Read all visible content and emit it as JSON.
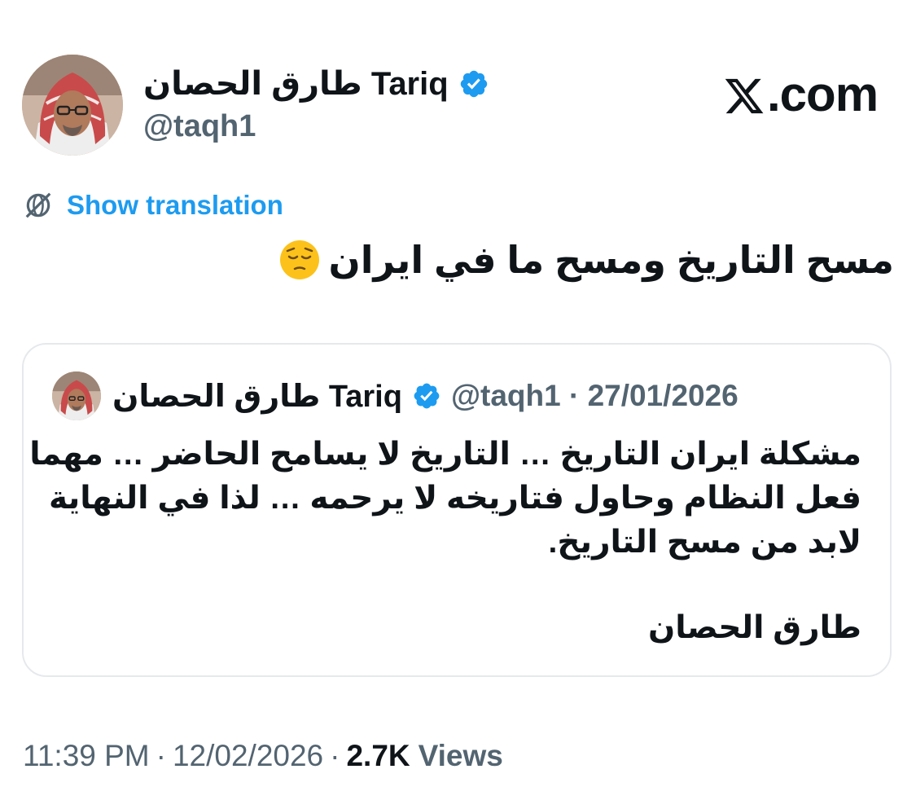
{
  "colors": {
    "verified_badge": "#1d9bf0",
    "link": "#1d9bf0",
    "secondary_text": "#536471",
    "primary_text": "#0f1419",
    "card_border": "#e6e9ec"
  },
  "header": {
    "author_name": "طارق الحصان Tariq",
    "author_handle": "@taqh1",
    "verified_icon": "verified-badge-icon",
    "site_label": ".com",
    "site_logo_icon": "x-logo-icon"
  },
  "translation": {
    "icon": "globe-translate-icon",
    "label": "Show translation"
  },
  "tweet": {
    "text": "مسح التاريخ ومسح ما في ايران",
    "emoji_icon": "pensive-face-emoji"
  },
  "quoted_tweet": {
    "author_name": "طارق الحصان Tariq",
    "handle_date": "@taqh1 · 27/01/2026",
    "body_lines": [
      "مشكلة ايران التاريخ … التاريخ لا يسامح الحاضر … مهما",
      "فعل النظام وحاول فتاريخه لا يرحمه … لذا في النهاية",
      "لابد من مسح التاريخ."
    ],
    "signature": "طارق الحصان"
  },
  "footer": {
    "time": "11:39 PM",
    "date": "12/02/2026",
    "views_count": "2.7K",
    "views_label": "Views",
    "separator": "·"
  }
}
